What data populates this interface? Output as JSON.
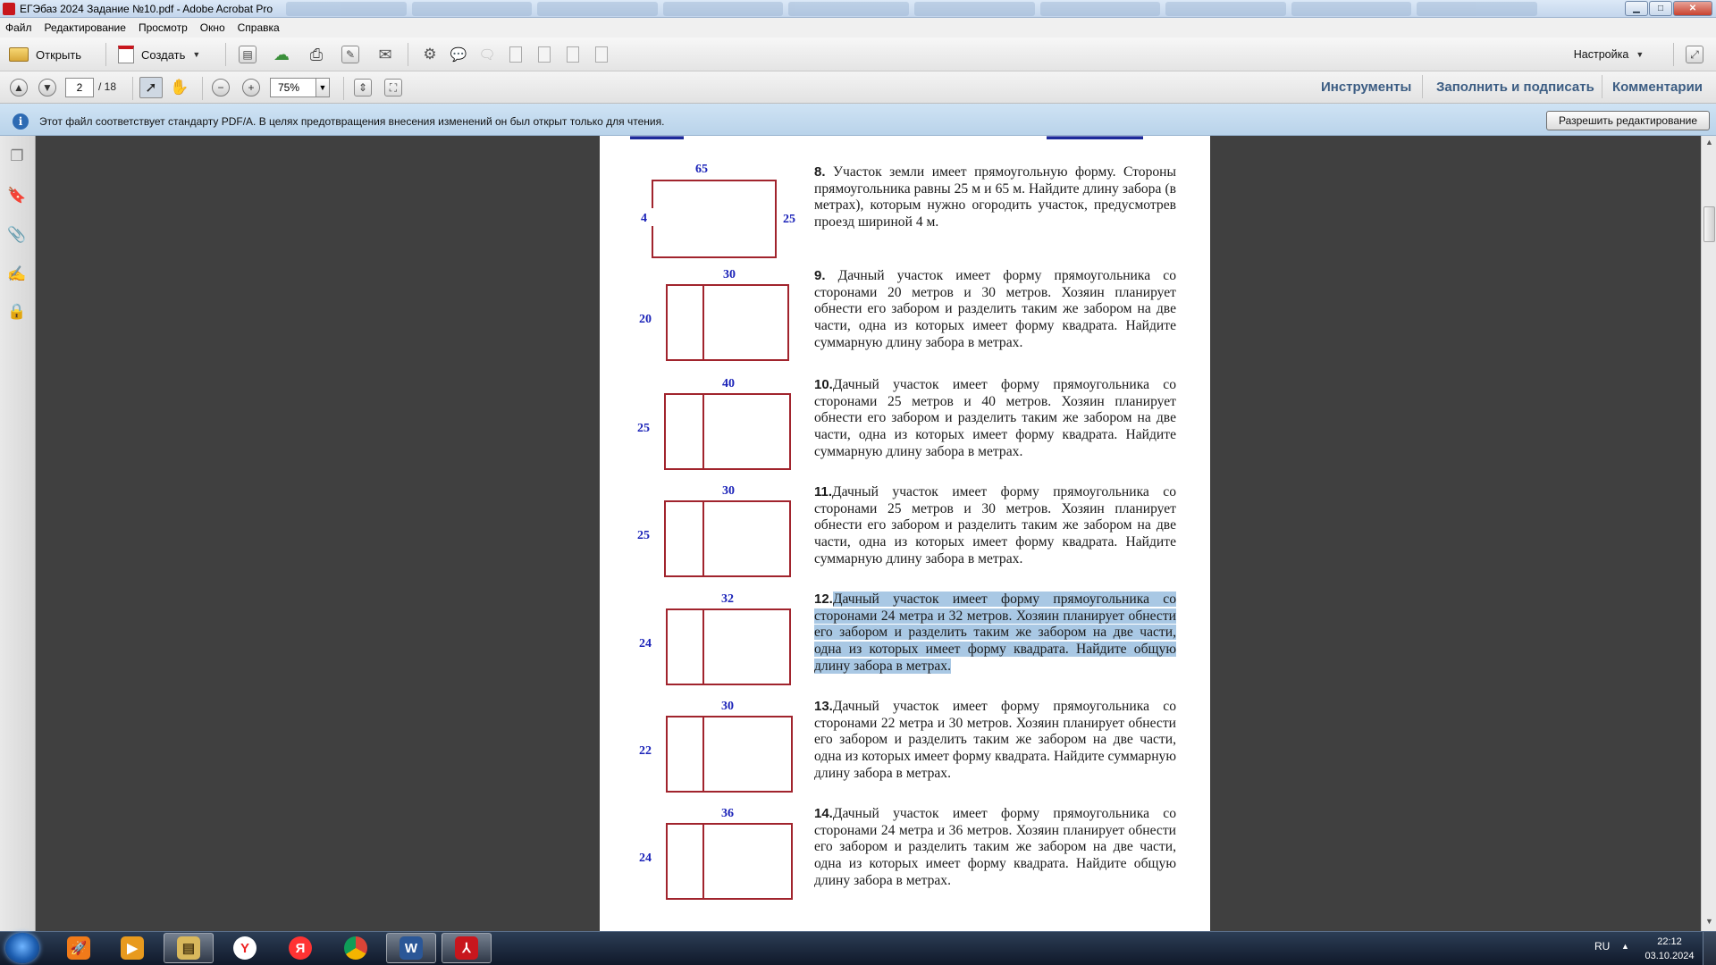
{
  "window": {
    "title": "ЕГЭбаз 2024 Задание №10.pdf - Adobe Acrobat Pro",
    "minimize_icon": "minimize-icon",
    "maximize_icon": "maximize-icon",
    "close_icon": "close-icon"
  },
  "menu": [
    "Файл",
    "Редактирование",
    "Просмотр",
    "Окно",
    "Справка"
  ],
  "toolbar": {
    "open_label": "Открыть",
    "create_label": "Создать",
    "customize_label": "Настройка"
  },
  "navigation": {
    "current_page": "2",
    "total_pages": "/ 18",
    "zoom": "75%"
  },
  "right_tabs": [
    "Инструменты",
    "Заполнить и подписать",
    "Комментарии"
  ],
  "infobar": {
    "message": "Этот файл соответствует стандарту PDF/A. В целях предотвращения внесения изменений он был открыт только для чтения.",
    "button_label": "Разрешить редактирование"
  },
  "page": {
    "tasks": [
      {
        "number": "8.",
        "text": "Участок земли имеет прямоугольную форму. Стороны прямоугольника равны 25 м и 65 м. Найдите длину забора (в метрах), которым нужно огородить участок, предусмотрев проезд шириной 4 м.",
        "figure": {
          "top": "65",
          "left": "4",
          "right": "25"
        }
      },
      {
        "number": "9.",
        "text": "Дачный участок имеет форму прямоугольника со сторонами 20 метров и 30 метров. Хозяин планирует обнести его забором и разделить таким же забором на две части, одна из которых имеет форму квадрата. Найдите суммарную длину забора в метрах.",
        "figure": {
          "top": "30",
          "left": "20"
        }
      },
      {
        "number": "10.",
        "text": "Дачный участок имеет форму прямоугольника со сторонами 25 метров и 40 метров. Хозяин планирует обнести его забором и разделить таким же забором на две части, одна из которых имеет форму квадрата. Найдите суммарную длину забора в метрах.",
        "figure": {
          "top": "40",
          "left": "25"
        }
      },
      {
        "number": "11.",
        "text": "Дачный участок имеет форму прямоугольника со сторонами 25 метров и 30 метров. Хозяин планирует обнести его забором и разделить таким же забором на две части, одна из которых имеет форму квадрата. Найдите суммарную длину забора в метрах.",
        "figure": {
          "top": "30",
          "left": "25"
        }
      },
      {
        "number": "12.",
        "text": "Дачный участок имеет форму прямоугольника со сторонами 24 метра и 32 метров. Хозяин планирует обнести его забором и разделить таким же забором на две части, одна из которых имеет форму квадрата. Найдите общую длину забора в метрах.",
        "figure": {
          "top": "32",
          "left": "24"
        }
      },
      {
        "number": "13.",
        "text": "Дачный участок имеет форму прямоугольника со сторонами 22 метра и 30 метров. Хозяин планирует обнести его забором и разделить таким же забором на две части, одна из которых имеет форму квадрата. Найдите суммарную длину забора в метрах.",
        "figure": {
          "top": "30",
          "left": "22"
        }
      },
      {
        "number": "14.",
        "text": "Дачный участок имеет форму прямоугольника со сторонами 24 метра и 36 метров. Хозяин планирует обнести его забором и разделить таким же забором на две части, одна из которых имеет форму квадрата. Найдите общую длину забора в метрах.",
        "figure": {
          "top": "36",
          "left": "24"
        }
      }
    ],
    "selected_task": "12."
  },
  "taskbar": {
    "language": "RU",
    "time": "22:12",
    "date": "03.10.2024"
  },
  "colors": {
    "accent": "#3c5d83",
    "figure_line": "#a1242d",
    "figure_label": "#1a22b8",
    "selection": "#a9c8e4"
  }
}
